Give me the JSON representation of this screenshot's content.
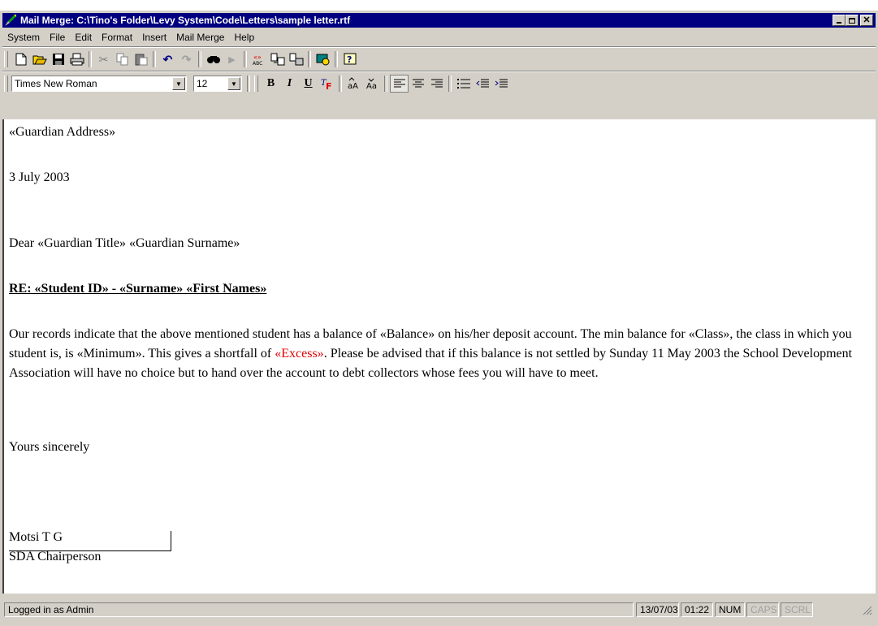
{
  "window": {
    "title": "Mail Merge: C:\\Tino's Folder\\Levy System\\Code\\Letters\\sample letter.rtf",
    "caption_buttons": [
      "minimize-icon",
      "maximize-icon",
      "close-icon"
    ]
  },
  "menu": {
    "system": "System",
    "file": "File",
    "edit": "Edit",
    "format": "Format",
    "insert": "Insert",
    "mailmerge": "Mail Merge",
    "help": "Help"
  },
  "toolbar": {
    "icons": [
      "new-icon",
      "open-icon",
      "save-icon",
      "print-icon",
      "cut-icon",
      "copy-icon",
      "paste-icon",
      "undo-icon",
      "redo-icon",
      "find-icon",
      "find-next-icon",
      "spell-icon",
      "merge-field-icon",
      "merge-all-icon",
      "preview-icon",
      "help-icon"
    ]
  },
  "format_bar": {
    "font": "Times New Roman",
    "size": "12",
    "bold": "B",
    "italic": "I",
    "underline": "U"
  },
  "document": {
    "line1": "«Guardian Address»",
    "line2": "3 July 2003",
    "line3": "Dear «Guardian Title» «Guardian Surname»",
    "line4": "RE: «Student ID» - «Surname» «First Names»",
    "body_a": "Our records indicate that the above mentioned student has a balance of «Balance» on his/her deposit account. The min balance for «Class», the class in which you student is, is «Minimum». This gives a shortfall of ",
    "body_excess": "«Excess»",
    "body_b": ". Please be advised that if this balance is not settled by Sunday 11 May 2003 the School Development Association will have no choice but to hand over the account to debt collectors whose fees you will have to meet.",
    "closing": "Yours sincerely",
    "signer": "Motsi T G",
    "signer_title": "SDA Chairperson",
    "excess_color": "#e00000"
  },
  "status": {
    "user": "Logged in as Admin",
    "date": "13/07/03",
    "time": "01:22",
    "num": "NUM",
    "caps": "CAPS",
    "scrl": "SCRL"
  }
}
